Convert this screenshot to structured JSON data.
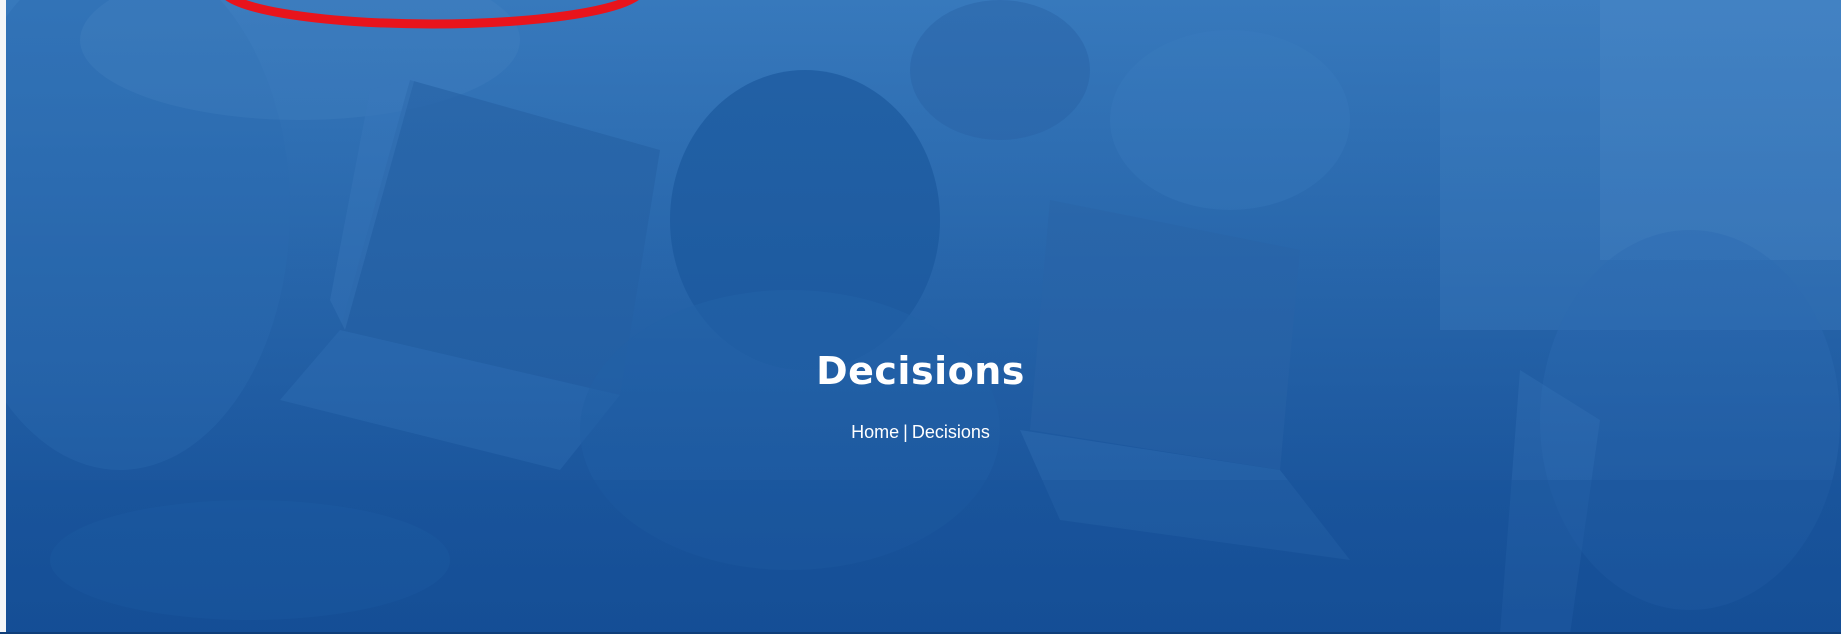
{
  "hero": {
    "title": "Decisions",
    "breadcrumb": {
      "home_label": "Home",
      "separator": "|",
      "current_label": "Decisions"
    },
    "background_color": "#2a69ad",
    "overlay_color": "#1a5499"
  },
  "annotation": {
    "shape": "ellipse",
    "color": "#e8141c"
  }
}
